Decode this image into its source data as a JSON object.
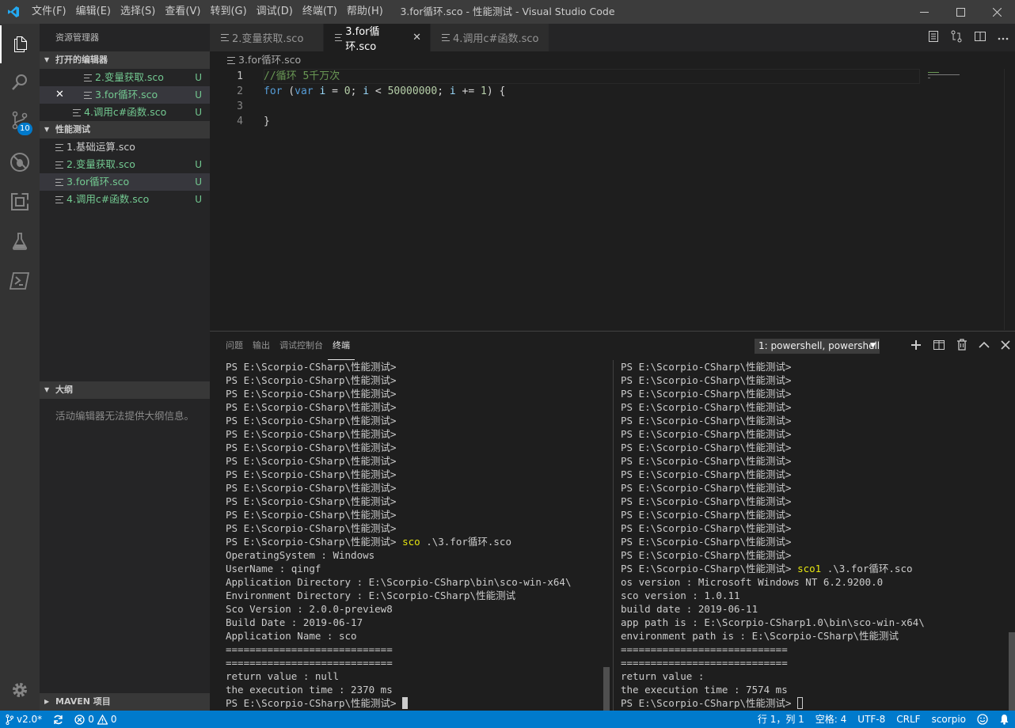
{
  "titlebar": {
    "menu": [
      "文件(F)",
      "编辑(E)",
      "选择(S)",
      "查看(V)",
      "转到(G)",
      "调试(D)",
      "终端(T)",
      "帮助(H)"
    ],
    "window_title": "3.for循环.sco - 性能测试 - Visual Studio Code"
  },
  "activitybar": {
    "scm_badge": "10"
  },
  "sidebar": {
    "title": "资源管理器",
    "open_editors": {
      "header": "打开的编辑器",
      "items": [
        {
          "name": "2.变量获取.sco",
          "status": "U"
        },
        {
          "name": "3.for循环.sco",
          "status": "U"
        },
        {
          "name": "4.调用c#函数.sco",
          "status": "U"
        }
      ]
    },
    "workspace": {
      "header": "性能测试",
      "items": [
        {
          "name": "1.基础运算.sco",
          "status": ""
        },
        {
          "name": "2.变量获取.sco",
          "status": "U"
        },
        {
          "name": "3.for循环.sco",
          "status": "U"
        },
        {
          "name": "4.调用c#函数.sco",
          "status": "U"
        }
      ]
    },
    "outline": {
      "header": "大纲",
      "message": "活动编辑器无法提供大纲信息。"
    },
    "maven": {
      "header": "MAVEN 项目"
    }
  },
  "editor": {
    "tabs": [
      "2.变量获取.sco",
      "3.for循环.sco",
      "4.调用c#函数.sco"
    ],
    "breadcrumb": "3.for循环.sco",
    "line_numbers": [
      "1",
      "2",
      "3",
      "4"
    ],
    "code": {
      "line1": "//循环 5千万次",
      "line2": {
        "kw1": "for",
        "p1": " (",
        "kw2": "var",
        "p2": " ",
        "v1": "i",
        "p3": " = ",
        "n1": "0",
        "p4": "; ",
        "v2": "i",
        "p5": " < ",
        "n2": "50000000",
        "p6": "; ",
        "v3": "i",
        "p7": " += ",
        "n3": "1",
        "p8": ") {"
      },
      "line4": "}"
    }
  },
  "panel": {
    "tabs": [
      "问题",
      "输出",
      "调试控制台",
      "终端"
    ],
    "terminal_select": "1: powershell, powershell",
    "terminal_left": {
      "empty_prompt": "PS E:\\Scorpio-CSharp\\性能测试>",
      "empty_count": 13,
      "command_prompt": "PS E:\\Scorpio-CSharp\\性能测试> ",
      "command": "sco",
      "command_arg": " .\\3.for循环.sco",
      "output": [
        "OperatingSystem : Windows",
        "UserName : qingf",
        "Application Directory : E:\\Scorpio-CSharp\\bin\\sco-win-x64\\",
        "Environment Directory : E:\\Scorpio-CSharp\\性能测试",
        "Sco Version : 2.0.0-preview8",
        "Build Date : 2019-06-17",
        "Application Name : sco",
        "============================",
        "============================",
        "return value : null",
        "the execution time : 2370 ms"
      ],
      "final_prompt": "PS E:\\Scorpio-CSharp\\性能测试> "
    },
    "terminal_right": {
      "empty_prompt": "PS E:\\Scorpio-CSharp\\性能测试>",
      "empty_count": 15,
      "command_prompt": "PS E:\\Scorpio-CSharp\\性能测试> ",
      "command": "sco1",
      "command_arg": " .\\3.for循环.sco",
      "output": [
        "os version : Microsoft Windows NT 6.2.9200.0",
        "sco version : 1.0.11",
        "build date : 2019-06-11",
        "app path is : E:\\Scorpio-CSharp1.0\\bin\\sco-win-x64\\",
        "environment path is : E:\\Scorpio-CSharp\\性能测试",
        "============================",
        "============================",
        "return value :",
        "the execution time : 7574 ms"
      ],
      "final_prompt": "PS E:\\Scorpio-CSharp\\性能测试> "
    }
  },
  "statusbar": {
    "branch": "v2.0*",
    "errors": "0",
    "warnings": "0",
    "position": "行 1，列 1",
    "indent": "空格: 4",
    "encoding": "UTF-8",
    "eol": "CRLF",
    "language": "scorpio"
  },
  "colors": {
    "accent": "#007acc",
    "untracked": "#73c991",
    "terminal_cmd": "#e5e510"
  }
}
